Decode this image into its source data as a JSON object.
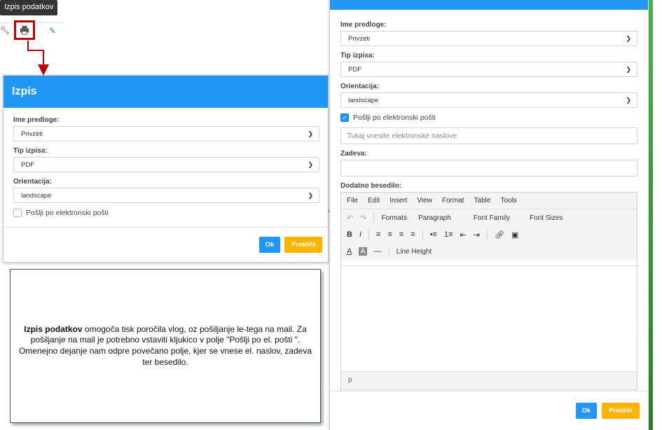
{
  "tooltip": "Izpis podatkov",
  "small_modal": {
    "title": "Izpis",
    "template_label": "Ime predloge:",
    "template_value": "Privzeti",
    "type_label": "Tip izpisa:",
    "type_value": "PDF",
    "orientation_label": "Orientacija:",
    "orientation_value": "landscape",
    "email_checkbox_label": "Pošlji po elektronski pošti",
    "ok_label": "Ok",
    "cancel_label": "Prekliči"
  },
  "caption": {
    "bold": "Izpis podatkov",
    "text": " omogoča tisk poročila vlog, oz pošiljanje le-tega na mail. Za pošiljanje na mail je potrebno vstaviti kljukico v polje \"Pošlji po el. pošti \". Omenejno dejanje nam odpre povečano polje, kjer se vnese el. naslov, zadeva ter besedilo."
  },
  "large_modal": {
    "template_label": "Ime predloge:",
    "template_value": "Privzeti",
    "type_label": "Tip izpisa:",
    "type_value": "PDF",
    "orientation_label": "Orientacija:",
    "orientation_value": "landscape",
    "email_checkbox_label": "Pošlji po elektronski pošti",
    "email_placeholder": "Tukaj vnesite elektronske naslove",
    "subject_label": "Zadeva:",
    "body_label": "Dodatno besedilo:",
    "menu": [
      "File",
      "Edit",
      "Insert",
      "View",
      "Format",
      "Table",
      "Tools"
    ],
    "formats_label": "Formats",
    "paragraph_label": "Paragraph",
    "font_family_label": "Font Family",
    "font_sizes_label": "Font Sizes",
    "line_height_label": "Line Height",
    "status_path": "p",
    "ok_label": "Ok",
    "cancel_label": "Prekliči"
  },
  "colors": {
    "primary": "#2196f3",
    "cancel": "#ffb300",
    "callout": "#c00000"
  }
}
